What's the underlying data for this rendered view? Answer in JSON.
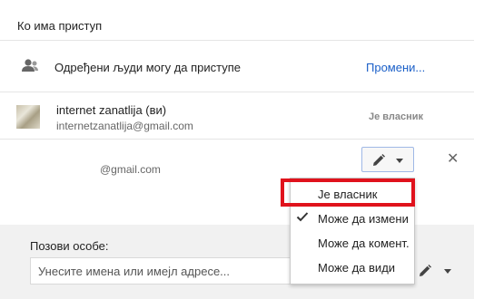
{
  "section_title": "Ко има приступ",
  "access_row": {
    "text": "Одређени људи могу да приступе",
    "change_link": "Промени..."
  },
  "owner_row": {
    "name": "internet zanatlija (ви)",
    "email": "internetzanatlija@gmail.com",
    "role": "Је власник"
  },
  "shared_row": {
    "email": "@gmail.com"
  },
  "invite": {
    "label": "Позови особе:",
    "placeholder": "Унесите имена или имејл адресе..."
  },
  "permission_menu": {
    "items": [
      {
        "label": "Је власник",
        "checked": false,
        "highlighted": true
      },
      {
        "label": "Може да измени",
        "checked": true,
        "highlighted": false
      },
      {
        "label": "Може да комент.",
        "checked": false,
        "highlighted": false
      },
      {
        "label": "Може да види",
        "checked": false,
        "highlighted": false
      }
    ]
  },
  "colors": {
    "link": "#1a5fc8",
    "highlight": "#e0121c"
  }
}
